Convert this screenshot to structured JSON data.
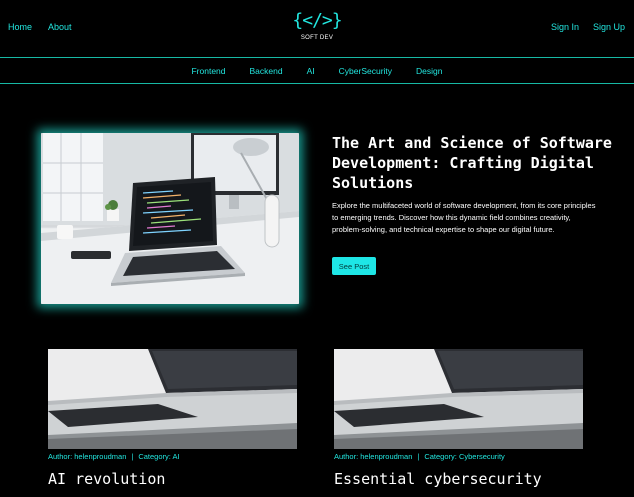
{
  "header": {
    "left_links": [
      "Home",
      "About"
    ],
    "right_links": [
      "Sign In",
      "Sign Up"
    ],
    "logo_mark": "{</>}",
    "logo_text": "SOFT DEV"
  },
  "categories": [
    "Frontend",
    "Backend",
    "AI",
    "CyberSecurity",
    "Design"
  ],
  "hero": {
    "title": "The Art and Science of Software Development: Crafting Digital Solutions",
    "description": "Explore the multifaceted world of software development, from its core principles to emerging trends. Discover how this dynamic field combines creativity, problem-solving, and technical expertise to shape our digital future.",
    "button_label": "See Post"
  },
  "posts": [
    {
      "author_label": "Author: helenproudman",
      "separator": "|",
      "category_label": "Category: AI",
      "title": "AI revolution"
    },
    {
      "author_label": "Author: helenproudman",
      "separator": "|",
      "category_label": "Category: Cybersecurity",
      "title": "Essential cybersecurity"
    }
  ],
  "colors": {
    "background": "#000000",
    "accent": "#22e6df",
    "divider": "#17b9a5",
    "text": "#ffffff"
  }
}
